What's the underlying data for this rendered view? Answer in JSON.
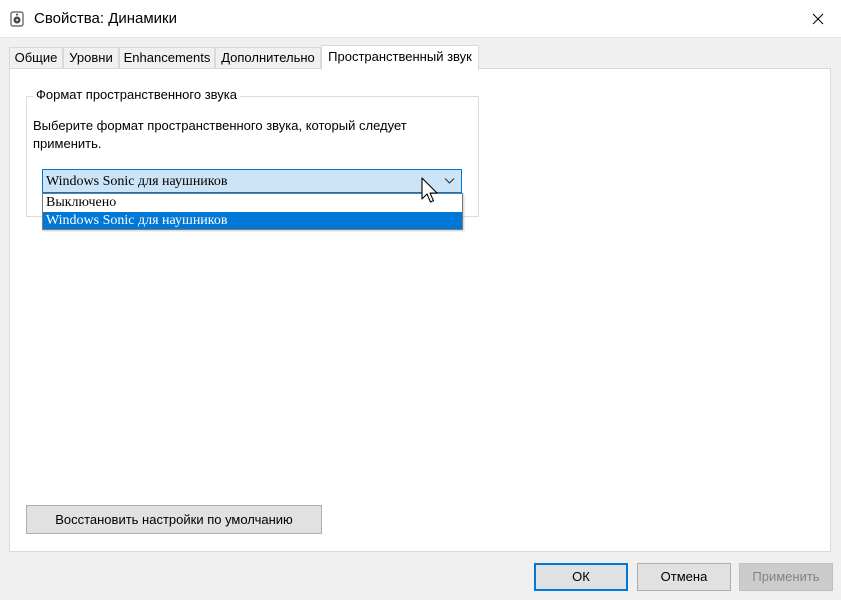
{
  "window": {
    "title": "Свойства: Динамики",
    "close_icon": "close-icon",
    "app_icon": "speaker-icon"
  },
  "tabs": [
    {
      "label": "Общие"
    },
    {
      "label": "Уровни"
    },
    {
      "label": "Enhancements"
    },
    {
      "label": "Дополнительно"
    },
    {
      "label": "Пространственный звук",
      "active": true
    }
  ],
  "spatial": {
    "group_label": "Формат пространственного звука",
    "description": "Выберите формат пространственного звука, который следует применить.",
    "selected_value": "Windows Sonic для наушников",
    "options": [
      {
        "label": "Выключено",
        "selected": false
      },
      {
        "label": "Windows Sonic для наушников",
        "selected": true
      }
    ]
  },
  "buttons": {
    "restore": "Восстановить настройки по умолчанию",
    "ok": "ОК",
    "cancel": "Отмена",
    "apply": "Применить"
  },
  "colors": {
    "accent": "#0078d7",
    "selection_text": "#ffffff",
    "disabled_text": "#838383"
  }
}
